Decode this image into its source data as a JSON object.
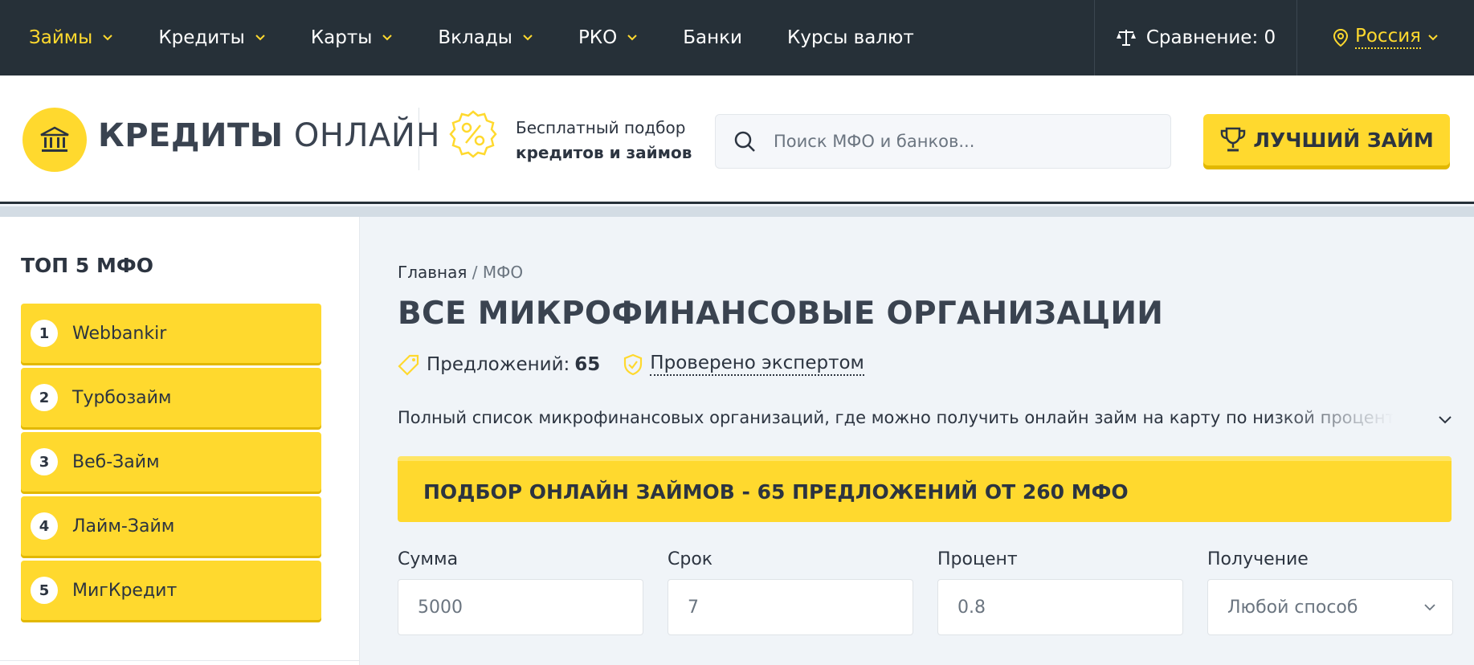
{
  "nav": {
    "items": [
      {
        "label": "Займы",
        "active": true,
        "dropdown": true
      },
      {
        "label": "Кредиты",
        "active": false,
        "dropdown": true
      },
      {
        "label": "Карты",
        "active": false,
        "dropdown": true
      },
      {
        "label": "Вклады",
        "active": false,
        "dropdown": true
      },
      {
        "label": "РКО",
        "active": false,
        "dropdown": true
      },
      {
        "label": "Банки",
        "active": false,
        "dropdown": false
      },
      {
        "label": "Курсы валют",
        "active": false,
        "dropdown": false
      }
    ],
    "compare_label": "Сравнение: 0",
    "region": "Россия"
  },
  "header": {
    "logo_bold": "КРЕДИТЫ",
    "logo_light": "ОНЛАЙН",
    "promo_line1": "Бесплатный подбор",
    "promo_line2": "кредитов и займов",
    "search_placeholder": "Поиск МФО и банков...",
    "best_button": "ЛУЧШИЙ ЗАЙМ"
  },
  "sidebar": {
    "title": "ТОП 5 МФО",
    "items": [
      {
        "num": "1",
        "name": "Webbankir"
      },
      {
        "num": "2",
        "name": "Турбозайм"
      },
      {
        "num": "3",
        "name": "Веб-Займ"
      },
      {
        "num": "4",
        "name": "Лайм-Займ"
      },
      {
        "num": "5",
        "name": "МигКредит"
      }
    ]
  },
  "main": {
    "breadcrumb_home": "Главная",
    "breadcrumb_sep": "/",
    "breadcrumb_current": "МФО",
    "title": "ВСЕ МИКРОФИНАНСОВЫЕ ОРГАНИЗАЦИИ",
    "offers_label": "Предложений:",
    "offers_count": "65",
    "verified": "Проверено экспертом",
    "description": "Полный список микрофинансовых организаций, где можно получить онлайн займ на карту по низкой процентной",
    "banner": "ПОДБОР ОНЛАЙН ЗАЙМОВ - 65 ПРЕДЛОЖЕНИЙ ОТ 260 МФО",
    "filters": {
      "sum_label": "Сумма",
      "sum_value": "5000",
      "term_label": "Срок",
      "term_value": "7",
      "rate_label": "Процент",
      "rate_value": "0.8",
      "method_label": "Получение",
      "method_value": "Любой способ"
    }
  },
  "colors": {
    "accent": "#ffd92e",
    "nav_bg": "#263038",
    "text": "#2c3440",
    "page_bg": "#f0f4f8"
  }
}
